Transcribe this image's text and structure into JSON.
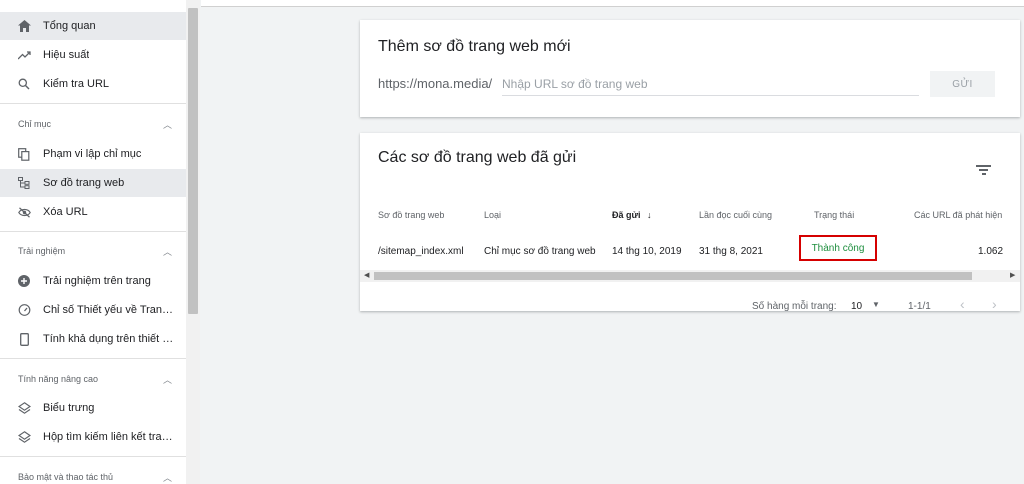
{
  "sidebar": {
    "items_top": [
      {
        "label": "Tổng quan",
        "icon": "home-icon",
        "active": true
      },
      {
        "label": "Hiệu suất",
        "icon": "trending-up-icon"
      },
      {
        "label": "Kiểm tra URL",
        "icon": "search-icon"
      }
    ],
    "section_index": {
      "title": "Chỉ mục",
      "items": [
        {
          "label": "Phạm vi lập chỉ mục",
          "icon": "copy-icon"
        },
        {
          "label": "Sơ đồ trang web",
          "icon": "sitemap-icon",
          "active": true
        },
        {
          "label": "Xóa URL",
          "icon": "eye-off-icon"
        }
      ]
    },
    "section_experience": {
      "title": "Trải nghiệm",
      "items": [
        {
          "label": "Trải nghiệm trên trang",
          "icon": "plus-circle-icon"
        },
        {
          "label": "Chỉ số Thiết yếu về Trang ...",
          "icon": "gauge-icon"
        },
        {
          "label": "Tính khả dụng trên thiết b...",
          "icon": "smartphone-icon"
        }
      ]
    },
    "section_enhancements": {
      "title": "Tính năng nâng cao",
      "items": [
        {
          "label": "Biểu trưng",
          "icon": "layers-icon"
        },
        {
          "label": "Hộp tìm kiếm liên kết tran...",
          "icon": "layers-icon"
        }
      ]
    },
    "section_security": {
      "title": "Bảo mật và thao tác thủ"
    }
  },
  "add_sitemap": {
    "title": "Thêm sơ đồ trang web mới",
    "prefix": "https://mona.media/",
    "placeholder": "Nhập URL sơ đồ trang web",
    "submit_label": "GỬI"
  },
  "submitted": {
    "title": "Các sơ đồ trang web đã gửi",
    "columns": {
      "sitemap": "Sơ đồ trang web",
      "type": "Loại",
      "submitted": "Đã gửi",
      "last_read": "Lần đọc cuối cùng",
      "status": "Trạng thái",
      "discovered": "Các URL đã phát hiện"
    },
    "row": {
      "sitemap": "/sitemap_index.xml",
      "type": "Chỉ mục sơ đồ trang web",
      "submitted": "14 thg 10, 2019",
      "last_read": "31 thg 8, 2021",
      "status": "Thành công",
      "discovered": "1.062"
    },
    "pagination": {
      "rows_label": "Số hàng mỗi trang:",
      "rows_value": "10",
      "range": "1-1/1"
    }
  },
  "colors": {
    "status_success": "#1e8e3e",
    "highlight_border": "#d50000"
  }
}
